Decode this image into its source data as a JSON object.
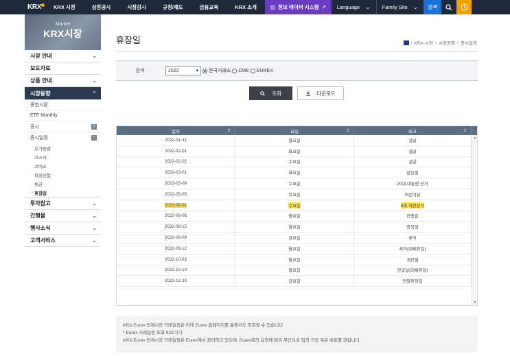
{
  "topnav": {
    "logo": "KRX",
    "items": [
      "KRX 시장",
      "상장공시",
      "시장감시",
      "규정/제도",
      "금융교육",
      "KRX 소개"
    ],
    "data_system": "정보 데이터 시스템",
    "language": "Language",
    "family_site": "Family Site",
    "search": "검색"
  },
  "sidebar": {
    "header_sub": "Market",
    "header_main": "KRX시장",
    "menu": [
      "시장 안내",
      "보도자료",
      "상품 안내",
      "시장동향"
    ],
    "submenu": [
      "종합시황",
      "ETF Monthly",
      "공시",
      "증시일정"
    ],
    "subsub": [
      "유가증권",
      "코스닥",
      "코넥스",
      "파생상품",
      "채권",
      "휴장일"
    ],
    "menu_after": [
      "투자참고",
      "간행물",
      "행사소식",
      "고객서비스"
    ]
  },
  "main": {
    "title": "휴장일",
    "breadcrumb": [
      "KRX 시장",
      "시장동향",
      "증시일정"
    ],
    "search_label": "검색",
    "year": "2022",
    "radios": [
      "한국거래소",
      "CME",
      "EUREX"
    ],
    "query_button": "조회",
    "download_button": "다운로드"
  },
  "table": {
    "headers": [
      "일자",
      "요일",
      "비고"
    ],
    "rows": [
      [
        "2022-01-31",
        "월요일",
        "설날"
      ],
      [
        "2022-02-01",
        "화요일",
        "설날"
      ],
      [
        "2022-02-02",
        "수요일",
        "설날"
      ],
      [
        "2022-03-01",
        "화요일",
        "삼일절"
      ],
      [
        "2022-03-09",
        "수요일",
        "20대 대통령 선거"
      ],
      [
        "2022-05-05",
        "목요일",
        "어린이날"
      ],
      [
        "2022-06-01",
        "수요일",
        "8회 지방선거"
      ],
      [
        "2022-06-06",
        "월요일",
        "현충일"
      ],
      [
        "2022-08-15",
        "월요일",
        "광복절"
      ],
      [
        "2022-09-09",
        "금요일",
        "추석"
      ],
      [
        "2022-09-12",
        "월요일",
        "추석(대체휴일)"
      ],
      [
        "2022-10-03",
        "월요일",
        "개천절"
      ],
      [
        "2022-10-10",
        "월요일",
        "한글날(대체휴일)"
      ],
      [
        "2022-12-30",
        "금요일",
        "연말휴장일"
      ]
    ],
    "highlight_row": 6
  },
  "notes": [
    "KRX-Eurex 연계시장 거래일정은 아래 Eurex 홈페이지를 통해서도 조회할 수 있습니다",
    "* Eurex 거래일정 조회 바로가기",
    "KRX-Eurex 연계시장 거래일정은 Eurex에서 관리하고 있으며, Eurex측의 요청에 따라 무단으로 임의 가공 혹은 배포를 금합니다."
  ],
  "colors": {
    "nav_bg": "#1e2a3a",
    "data_system": "#6a3cc4",
    "search_blue": "#1773d8",
    "user_orange": "#f4a100",
    "table_header": "#5d6d82",
    "highlight": "#ffe24a"
  }
}
